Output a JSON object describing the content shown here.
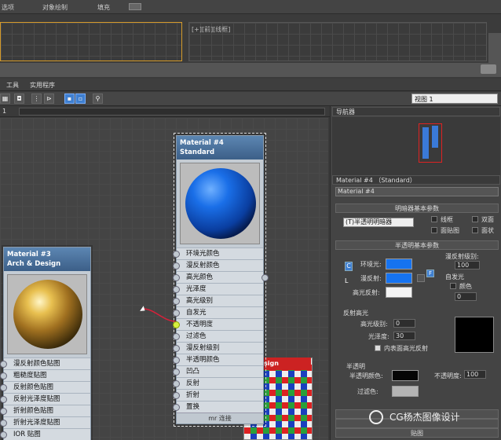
{
  "top_menu": {
    "items": [
      "选项",
      "对象绘制",
      "填充"
    ]
  },
  "viewport": {
    "label": "[+][前][线框]"
  },
  "editor_menu": {
    "items": [
      "工具",
      "实用程序"
    ]
  },
  "view_select": "视图 1",
  "crumb_left": "1",
  "navigator": {
    "title": "导航器"
  },
  "nodes": {
    "material4": {
      "title": "Material #4",
      "type": "Standard",
      "slots": [
        "环境光颜色",
        "漫反射颜色",
        "高光颜色",
        "光泽度",
        "高光级别",
        "自发光",
        "不透明度",
        "过滤色",
        "漫反射级别",
        "半透明颜色",
        "凹凸",
        "反射",
        "折射",
        "置换"
      ],
      "connect_label": "mr 连接"
    },
    "material3": {
      "title": "Material #3",
      "type": "Arch & Design",
      "slots": [
        "漫反射颜色贴图",
        "粗糙度贴图",
        "反射颜色贴图",
        "反射光泽度贴图",
        "折射颜色贴图",
        "折射光泽度贴图",
        "IOR 贴图"
      ]
    },
    "back_node": {
      "title": "sign"
    }
  },
  "panel": {
    "header": "Material #4 （Standard）",
    "name_field": "Material #4",
    "shader_rollout": "明暗器基本参数",
    "shader_select": "(T)半透明明暗器",
    "shader_checks": [
      "线框",
      "双面",
      "面贴图",
      "面状"
    ],
    "basic_rollout": "半透明基本参数",
    "ambient_label": "环境光:",
    "diffuse_label": "漫反射:",
    "specular_label": "高光反射:",
    "diffuse_level_label": "漫反射级别:",
    "diffuse_level_value": "100",
    "self_illum_label": "自发光",
    "self_illum_color_label": "颜色",
    "self_illum_value": "0",
    "spec_section": "反射高光",
    "spec_level_label": "高光级别:",
    "spec_level_value": "0",
    "gloss_label": "光泽度:",
    "gloss_value": "30",
    "inner_spec_label": "内表面高光反射",
    "translucency_section": "半透明",
    "transl_color_label": "半透明颜色:",
    "opacity_label": "不透明度:",
    "opacity_value": "100",
    "filter_color_label": "过滤色:",
    "rollout_bottom_2": "贴图",
    "letter_c": "C",
    "letter_l": "L"
  },
  "watermark": "CG杨杰图像设计",
  "colors": {
    "ambient": "#1673f0",
    "diffuse": "#1673f0",
    "specular": "#f4f4f4",
    "spec_preview": "#000000",
    "transl": "#050505",
    "filter": "#b4b4b4"
  }
}
